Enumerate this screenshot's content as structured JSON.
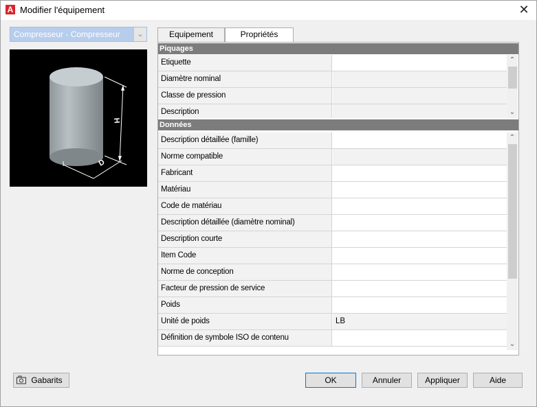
{
  "window": {
    "title": "Modifier l'équipement",
    "app_icon_letter": "A",
    "close_glyph": "✕"
  },
  "equipment_select": {
    "selected": "Compresseur - Compresseur",
    "arrow": "⌄"
  },
  "preview": {
    "dimension_h": "H",
    "dimension_d": "D"
  },
  "tabs": [
    {
      "label": "Equipement",
      "active": false
    },
    {
      "label": "Propriétés",
      "active": true
    }
  ],
  "sections": {
    "piquages": {
      "title": "Piquages",
      "rows": [
        {
          "label": "Etiquette",
          "value": "",
          "editable": true
        },
        {
          "label": "Diamètre nominal",
          "value": "",
          "editable": false
        },
        {
          "label": "Classe de pression",
          "value": "",
          "editable": false
        },
        {
          "label": "Description",
          "value": "",
          "editable": false
        }
      ]
    },
    "donnees": {
      "title": "Données",
      "rows": [
        {
          "label": "Description détaillée (famille)",
          "value": "",
          "editable": true
        },
        {
          "label": "Norme compatible",
          "value": "",
          "editable": false
        },
        {
          "label": "Fabricant",
          "value": "",
          "editable": true
        },
        {
          "label": "Matériau",
          "value": "",
          "editable": true
        },
        {
          "label": "Code de matériau",
          "value": "",
          "editable": true
        },
        {
          "label": "Description détaillée (diamètre nominal)",
          "value": "",
          "editable": true
        },
        {
          "label": "Description courte",
          "value": "",
          "editable": true
        },
        {
          "label": "Item Code",
          "value": "",
          "editable": true
        },
        {
          "label": "Norme de conception",
          "value": "",
          "editable": true
        },
        {
          "label": "Facteur de pression de service",
          "value": "",
          "editable": true
        },
        {
          "label": "Poids",
          "value": "",
          "editable": true
        },
        {
          "label": "Unité de poids",
          "value": "LB",
          "editable": false
        },
        {
          "label": "Définition de symbole ISO de contenu",
          "value": "",
          "editable": true
        }
      ]
    }
  },
  "scroll": {
    "up": "⌃",
    "down": "⌄"
  },
  "buttons": {
    "gabarits": "Gabarits",
    "ok": "OK",
    "cancel": "Annuler",
    "apply": "Appliquer",
    "help": "Aide"
  },
  "colors": {
    "accent": "#0078d7",
    "section_header": "#7c7c7c",
    "combo_bg": "#b7cdec",
    "app_icon": "#d8262b"
  }
}
